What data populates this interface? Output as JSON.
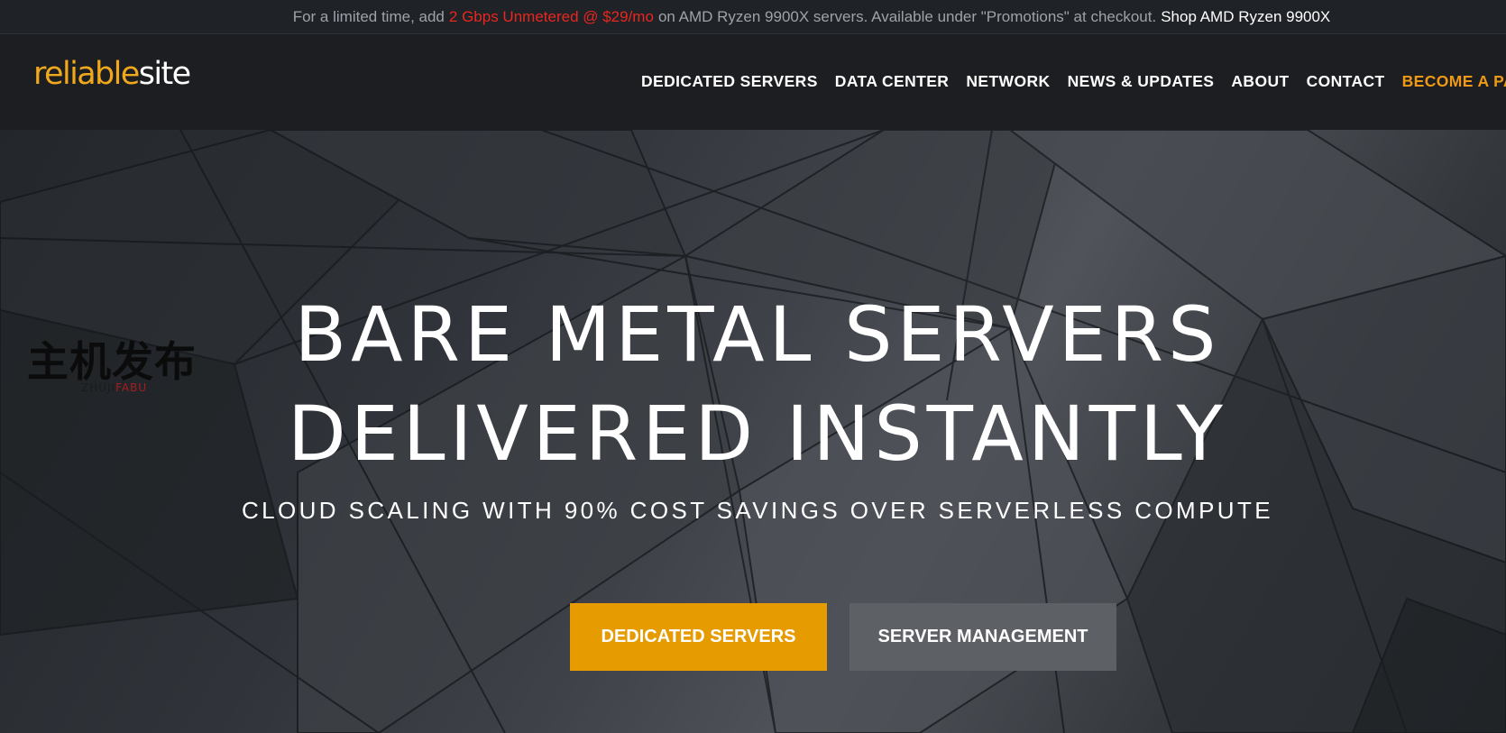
{
  "promo": {
    "prefix": "For a limited time, add",
    "highlight": "2 Gbps Unmetered @ $29/mo",
    "suffix": "on AMD Ryzen 9900X servers. Available under \"Promotions\" at checkout.",
    "link": "Shop AMD Ryzen 9900X",
    "highlight_color": "#e8271f"
  },
  "header": {
    "logo": {
      "part1": "reliable",
      "part2": "site"
    },
    "nav": [
      "DEDICATED SERVERS",
      "DATA CENTER",
      "NETWORK",
      "NEWS & UPDATES",
      "ABOUT",
      "CONTACT",
      "BECOME A PARTNE"
    ],
    "accent_color": "#ee9a16"
  },
  "hero": {
    "line1": "BARE METAL SERVERS",
    "line2": "DELIVERED INSTANTLY",
    "subline": "CLOUD SCALING WITH 90% COST SAVINGS OVER SERVERLESS COMPUTE",
    "primary_button": "DEDICATED SERVERS",
    "secondary_button": "SERVER MANAGEMENT",
    "primary_color": "#e69b00",
    "secondary_color": "#5d6166"
  },
  "watermark": {
    "cn": "主机发布",
    "en1": "ZHUJI",
    "en2": "FABU"
  }
}
